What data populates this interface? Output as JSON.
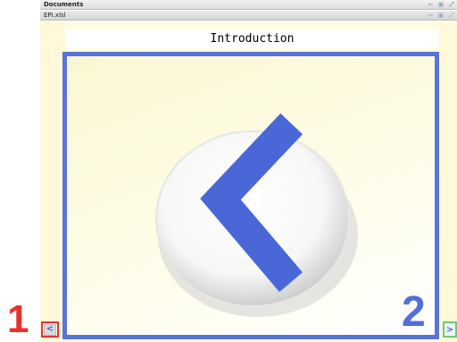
{
  "window": {
    "documents_title": "Documents",
    "file_title": "EPI.xlsl"
  },
  "slide": {
    "title": "Introduction"
  },
  "callouts": {
    "one": "1",
    "two": "2"
  },
  "nav": {
    "prev_glyph": "<",
    "next_glyph": ">"
  },
  "icons": {
    "title_controls": [
      "back-arrow-icon",
      "restore-icon",
      "expand-icon"
    ],
    "slide_graphic": "back-chevron-icon",
    "prev": "chevron-left-icon",
    "next": "chevron-right-icon"
  },
  "colors": {
    "frame_blue": "#5a74d8",
    "callout_red": "#e8312b",
    "callout_blue": "#5070d8",
    "next_green": "#6ccc6c",
    "chevron_blue": "#4462d6"
  }
}
